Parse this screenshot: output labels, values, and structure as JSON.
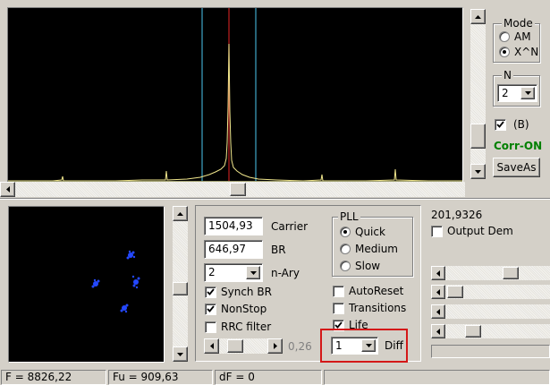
{
  "mode": {
    "title": "Mode",
    "options": [
      "AM",
      "X^N"
    ],
    "selected": "X^N"
  },
  "n": {
    "title": "N",
    "value": "2"
  },
  "b_check": {
    "label": "(B)",
    "checked": true
  },
  "corr_status": {
    "text": "Corr-ON",
    "color": "#008000"
  },
  "save_as_label": "SaveAs",
  "fields": {
    "carrier": {
      "value": "1504,93",
      "label": "Carrier"
    },
    "br": {
      "value": "646,97",
      "label": "BR"
    },
    "nary": {
      "value": "2",
      "label": "n-Ary"
    }
  },
  "checks_left": [
    {
      "label": "Synch BR",
      "checked": true
    },
    {
      "label": "NonStop",
      "checked": true
    },
    {
      "label": "RRC filter",
      "checked": false
    }
  ],
  "slider_value": "0,26",
  "pll": {
    "title": "PLL",
    "options": [
      "Quick",
      "Medium",
      "Slow"
    ],
    "selected": "Quick"
  },
  "checks_right": [
    {
      "label": "AutoReset",
      "checked": false
    },
    {
      "label": "Transitions",
      "checked": false
    },
    {
      "label": "Life",
      "checked": true
    }
  ],
  "diff": {
    "value": "1",
    "label": "Diff"
  },
  "readout": "201,9326",
  "output_dem": {
    "label": "Output Dem",
    "checked": false
  },
  "status_bar": {
    "f": "F = 8826,22",
    "fu": "Fu = 909,63",
    "df": "dF = 0"
  },
  "colors": {
    "spectrum_trace": "#f0e68c",
    "marker_cyan": "#3fa7c8",
    "marker_red": "#c02020",
    "highlight_box": "#d41818",
    "constellation_dot": "#2448ff"
  },
  "icons": {
    "arrow_left": "triangle-left",
    "arrow_right": "triangle-right",
    "arrow_up": "triangle-up",
    "arrow_down": "triangle-down",
    "check": "check-mark"
  }
}
